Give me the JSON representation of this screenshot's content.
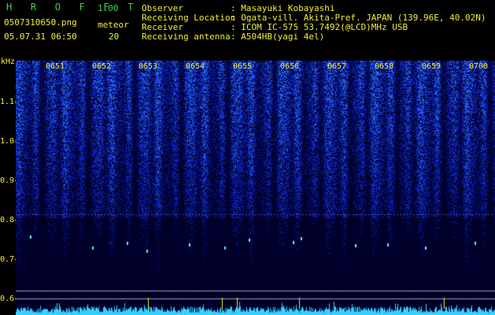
{
  "header": {
    "app_title": "H R O F F T",
    "version": "1.00",
    "filename": "0507310650.png",
    "datetime": "05.07.31 06:50",
    "meteor_label": "meteor",
    "meteor_count": "20"
  },
  "info": {
    "observer_label": "Observer",
    "observer_value": ": Masayuki Kobayashi",
    "location_label": "Receiving Location",
    "location_value": ": Ogata-vill. Akita-Pref. JAPAN (139.96E, 40.02N)",
    "receiver_label": "Receiver",
    "receiver_value": ": ICOM IC-575 53.7492(@LCD)MHz USB",
    "antenna_label": "Receiving antenna",
    "antenna_value": ": A504HB(yagi 4el)"
  },
  "y_axis": {
    "unit": "kHz",
    "ticks": [
      "1.1",
      "1.0",
      "0.9",
      "0.8",
      "0.7",
      "0.6"
    ]
  },
  "time_axis": {
    "labels": [
      "0651",
      "0652",
      "0653",
      "0654",
      "0655",
      "0656",
      "0657",
      "0658",
      "0659",
      "0700"
    ]
  },
  "colors": {
    "background": "#000000",
    "header_green": "#39d353",
    "header_yellow": "#f2ef2f",
    "waterfall_blue": "#1a35c8",
    "signal_line": "#35d0ff"
  }
}
